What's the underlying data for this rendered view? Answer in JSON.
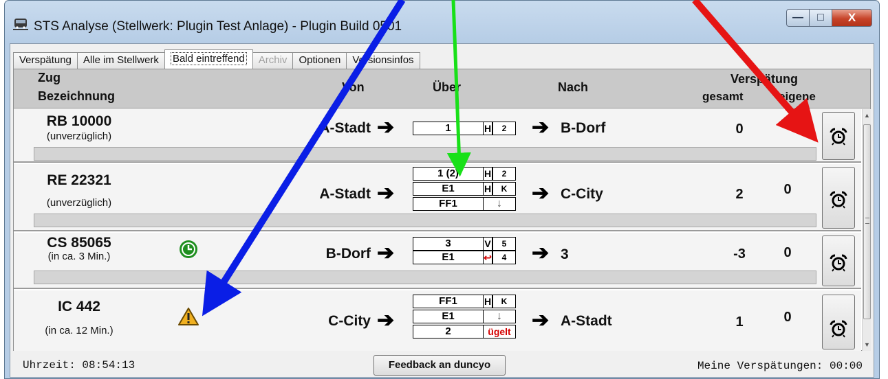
{
  "window": {
    "title": "STS Analyse (Stellwerk: Plugin Test Anlage) - Plugin Build 0501",
    "controls": {
      "minimize": "—",
      "maximize": "□",
      "close": "X"
    }
  },
  "tabs": [
    {
      "label": "Verspätung"
    },
    {
      "label": "Alle im Stellwerk"
    },
    {
      "label": "Bald eintreffend"
    },
    {
      "label": "Archiv"
    },
    {
      "label": "Optionen"
    },
    {
      "label": "Versionsinfos"
    }
  ],
  "columns": {
    "zug": "Zug",
    "bezeichnung": "Bezeichnung",
    "von": "Von",
    "ueber": "Über",
    "nach": "Nach",
    "verspaetung": "Verspätung",
    "gesamt": "gesamt",
    "eigene": "eigene"
  },
  "rows": [
    {
      "train": "RB 10000",
      "hint": "(unverzüglich)",
      "status_icon": "none",
      "from": "A-Stadt",
      "to": "B-Dorf",
      "via": [
        {
          "track": "1",
          "mark": "H",
          "info": "2"
        }
      ],
      "delay_total": "0",
      "delay_own": "0"
    },
    {
      "train": "RE 22321",
      "hint": "(unverzüglich)",
      "status_icon": "none",
      "from": "A-Stadt",
      "to": "C-City",
      "via": [
        {
          "track": "1 (2)",
          "mark": "H",
          "info": "2"
        },
        {
          "track": "E1",
          "mark": "H",
          "info": "K"
        },
        {
          "track": "FF1",
          "mark": "",
          "info": "↓"
        }
      ],
      "delay_total": "2",
      "delay_own": "0"
    },
    {
      "train": "CS 85065",
      "hint": "(in ca. 3 Min.)",
      "status_icon": "clock-green-icon",
      "from": "B-Dorf",
      "to": "3",
      "via": [
        {
          "track": "3",
          "mark": "V",
          "info": "5"
        },
        {
          "track": "E1",
          "mark": "↩",
          "info": "4"
        }
      ],
      "delay_total": "-3",
      "delay_own": "0"
    },
    {
      "train": "IC 442",
      "hint": "(in ca. 12 Min.)",
      "status_icon": "warning-icon",
      "from": "C-City",
      "to": "A-Stadt",
      "via": [
        {
          "track": "FF1",
          "mark": "H",
          "info": "K"
        },
        {
          "track": "E1",
          "mark": "",
          "info": "↓"
        },
        {
          "track": "2",
          "mark": "",
          "info": "ügelt"
        }
      ],
      "delay_total": "1",
      "delay_own": "0"
    }
  ],
  "status": {
    "time": "Uhrzeit: 08:54:13",
    "feedback_button": "Feedback an duncyo",
    "my_delay": "Meine Verspätungen:  00:00"
  },
  "colors": {
    "arrow_blue": "#0a1ee6",
    "arrow_green": "#18e018",
    "arrow_red": "#e61414",
    "clock_green": "#1f8f1f",
    "warning_yellow": "#f0b020"
  }
}
